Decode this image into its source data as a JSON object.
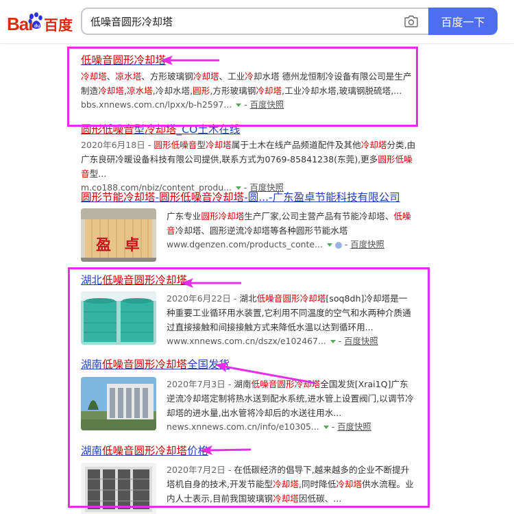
{
  "header": {
    "logo_bai": "Bai",
    "logo_cn": "百度",
    "query": "低噪音圆形冷却塔",
    "search_button": "百度一下"
  },
  "results": [
    {
      "title_parts": [
        {
          "t": "低噪音圆形冷却塔",
          "h": true
        }
      ],
      "abstract_parts": [
        {
          "t": "冷却塔",
          "h": true
        },
        {
          "t": "、",
          "h": false
        },
        {
          "t": "凉水塔",
          "h": true
        },
        {
          "t": "、方形玻璃钢",
          "h": false
        },
        {
          "t": "冷却塔",
          "h": true
        },
        {
          "t": "、工业",
          "h": false
        },
        {
          "t": "冷",
          "h": true
        },
        {
          "t": "却水塔 德州龙恒制冷设备有限公司是生产制造",
          "h": false
        },
        {
          "t": "冷却塔",
          "h": true
        },
        {
          "t": ",",
          "h": false
        },
        {
          "t": "凉水塔",
          "h": true
        },
        {
          "t": ",冷却水塔,",
          "h": false
        },
        {
          "t": "圆形",
          "h": true
        },
        {
          "t": ",方形玻璃钢",
          "h": false
        },
        {
          "t": "冷却塔",
          "h": true
        },
        {
          "t": ",工业冷却水塔,玻璃钢脱硫塔,...",
          "h": false
        }
      ],
      "url": "bbs.xnnews.com.cn/lpxx/b-h2597...",
      "snapshot": "百度快照"
    },
    {
      "title_parts": [
        {
          "t": "圆形低噪音",
          "h": true
        },
        {
          "t": "型",
          "h": false
        },
        {
          "t": "冷却塔",
          "h": true
        },
        {
          "t": "_CO土木在线",
          "h": false
        }
      ],
      "abstract_parts": [
        {
          "t": "2020年6月18日 - ",
          "h": false,
          "date": true
        },
        {
          "t": "圆形低噪音",
          "h": true
        },
        {
          "t": "型",
          "h": false
        },
        {
          "t": "冷却塔",
          "h": true
        },
        {
          "t": "属于土木在线产品频道配件及其他",
          "h": false
        },
        {
          "t": "冷却塔",
          "h": true
        },
        {
          "t": "分类,由广东良研冷暖设备科技有限公司提供,联系方式为0769-85841238(东莞),更多",
          "h": false
        },
        {
          "t": "圆形低噪音",
          "h": true
        },
        {
          "t": "型...",
          "h": false
        }
      ],
      "url": "m.co188.com/nbiz/content_produ...",
      "snapshot": "百度快照"
    },
    {
      "title_parts": [
        {
          "t": "圆形节能",
          "h": true
        },
        {
          "t": "冷却塔",
          "h": true
        },
        {
          "t": "-",
          "h": false
        },
        {
          "t": "圆形低噪音冷却塔",
          "h": true
        },
        {
          "t": "-圆...-广东盈卓节能科技有限公司",
          "h": false
        }
      ],
      "abstract_parts": [
        {
          "t": "广东专业",
          "h": false
        },
        {
          "t": "圆形",
          "h": true
        },
        {
          "t": "冷却塔",
          "h": true
        },
        {
          "t": "生产厂家,公司主营产品有节能冷却塔、",
          "h": false
        },
        {
          "t": "低噪音",
          "h": true
        },
        {
          "t": "冷却塔、圆形逆流冷却塔等各种圆形节能水塔",
          "h": false
        }
      ],
      "url": "www.dgenzen.com/products_conte...",
      "snapshot": "百度快照",
      "thumb_text": "盈 卓"
    },
    {
      "title_parts": [
        {
          "t": "湖北",
          "h": false
        },
        {
          "t": "低噪音圆形冷却塔",
          "h": true
        }
      ],
      "abstract_parts": [
        {
          "t": "2020年6月22日 - ",
          "h": false,
          "date": true
        },
        {
          "t": "湖北",
          "h": false
        },
        {
          "t": "低噪音圆形冷却塔",
          "h": true
        },
        {
          "t": "[soq8dh]冷却塔是一种重要工业循环用水装置,它利用不同温度的空气和水两种介质通过直接接触和间接接触方式来降低水温以达到循环用...",
          "h": false
        }
      ],
      "url": "www.xnnews.com.cn/dszx/e102467...",
      "snapshot": "百度快照"
    },
    {
      "title_parts": [
        {
          "t": "湖南",
          "h": false
        },
        {
          "t": "低噪音圆形冷却塔",
          "h": true
        },
        {
          "t": "全国发货",
          "h": false
        }
      ],
      "abstract_parts": [
        {
          "t": "2020年7月3日 - ",
          "h": false,
          "date": true
        },
        {
          "t": "湖南",
          "h": false
        },
        {
          "t": "低噪音圆形冷却塔",
          "h": true
        },
        {
          "t": "全国发货[Xrai1Q]广东逆流冷却塔定制将热水送到配水系统,进水管上设置阀门,以调节冷却塔的进水量,出水管将冷却后的水送往用水...",
          "h": false
        }
      ],
      "url": "news.xnnews.com.cn/info/e10305...",
      "snapshot": "百度快照"
    },
    {
      "title_parts": [
        {
          "t": "湖南",
          "h": false
        },
        {
          "t": "低噪音圆形冷却塔",
          "h": true
        },
        {
          "t": "价格",
          "h": false
        }
      ],
      "abstract_parts": [
        {
          "t": "2020年7月2日 - ",
          "h": false,
          "date": true
        },
        {
          "t": "在低碳经济的倡导下,越来越多的企业不断提升塔机自身的技术,开发节能型",
          "h": false
        },
        {
          "t": "冷却塔",
          "h": true
        },
        {
          "t": ",同时降低",
          "h": false
        },
        {
          "t": "冷却塔",
          "h": true
        },
        {
          "t": "供水流程。业内人士表示,目前我国玻璃钢",
          "h": false
        },
        {
          "t": "冷却塔",
          "h": true
        },
        {
          "t": "因低碳、...",
          "h": false
        }
      ],
      "url": "",
      "snapshot": ""
    }
  ],
  "colors": {
    "accent": "#4e6ef2",
    "link": "#2440b3",
    "highlight": "#c00000",
    "annotation": "#e62ee6",
    "logo": "#de2910"
  }
}
